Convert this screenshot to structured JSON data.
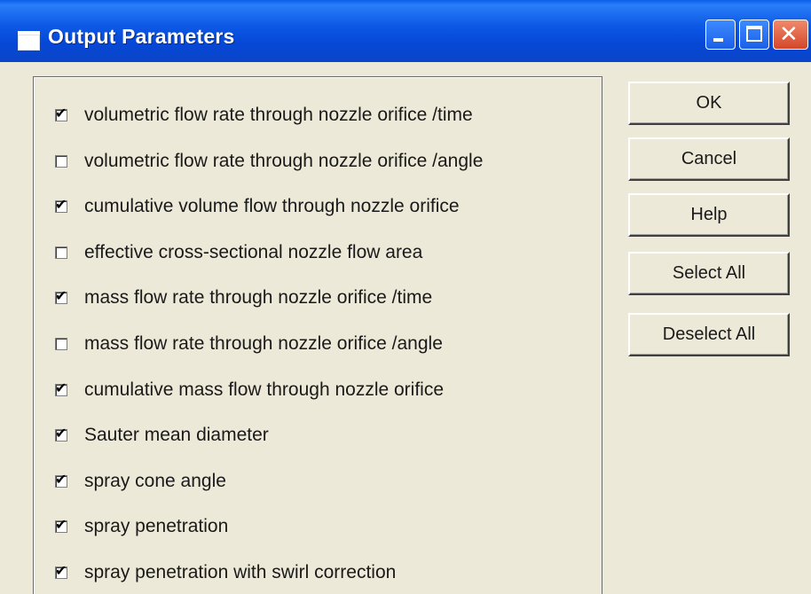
{
  "window": {
    "title": "Output Parameters",
    "controls": {
      "minimize_icon": "minimize-icon",
      "maximize_icon": "maximize-icon",
      "close_icon": "close-icon",
      "close_glyph": "✕"
    }
  },
  "options": [
    {
      "label": "volumetric flow rate through nozzle orifice /time",
      "checked": true
    },
    {
      "label": "volumetric flow rate through nozzle orifice /angle",
      "checked": false
    },
    {
      "label": "cumulative volume flow through nozzle orifice",
      "checked": true
    },
    {
      "label": "effective cross-sectional nozzle flow area",
      "checked": false
    },
    {
      "label": "mass flow rate through nozzle orifice /time",
      "checked": true
    },
    {
      "label": "mass flow rate through nozzle orifice /angle",
      "checked": false
    },
    {
      "label": "cumulative mass flow through nozzle orifice",
      "checked": true
    },
    {
      "label": "Sauter mean diameter",
      "checked": true
    },
    {
      "label": "spray cone angle",
      "checked": true
    },
    {
      "label": "spray penetration",
      "checked": true
    },
    {
      "label": "spray penetration with swirl correction",
      "checked": true
    }
  ],
  "buttons": {
    "ok": "OK",
    "cancel": "Cancel",
    "help": "Help",
    "select_all": "Select All",
    "deselect_all": "Deselect All"
  },
  "colors": {
    "titlebar": "#0a5ee8",
    "dialog_bg": "#ece9d8",
    "close_button": "#d4462a"
  }
}
